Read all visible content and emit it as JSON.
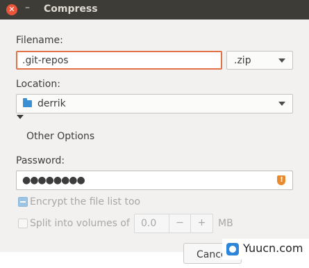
{
  "window": {
    "title": "Compress",
    "close_glyph": "✕",
    "minimize_glyph": "–"
  },
  "filename": {
    "label": "Filename:",
    "value": ".git-repos",
    "extension": ".zip"
  },
  "location": {
    "label": "Location:",
    "value": "derrik",
    "icon": "folder-icon"
  },
  "other_options": {
    "label": "Other Options",
    "expanded": true
  },
  "password": {
    "label": "Password:",
    "value": "●●●●●●●●",
    "warning_icon": "shield-warning-icon",
    "warning_glyph": "!"
  },
  "encrypt_list": {
    "label": "Encrypt the file list too",
    "checked": true
  },
  "split_volumes": {
    "label": "Split into volumes of",
    "value": "0.0",
    "minus": "−",
    "plus": "+",
    "unit": "MB",
    "checked": false
  },
  "footer": {
    "cancel_label": "Cancel"
  },
  "watermark": {
    "text": "Yuucn.com"
  },
  "colors": {
    "accent": "#e27049",
    "titlebar": "#3d3c37",
    "folder": "#3b8fd3",
    "warning": "#e98a2e"
  }
}
